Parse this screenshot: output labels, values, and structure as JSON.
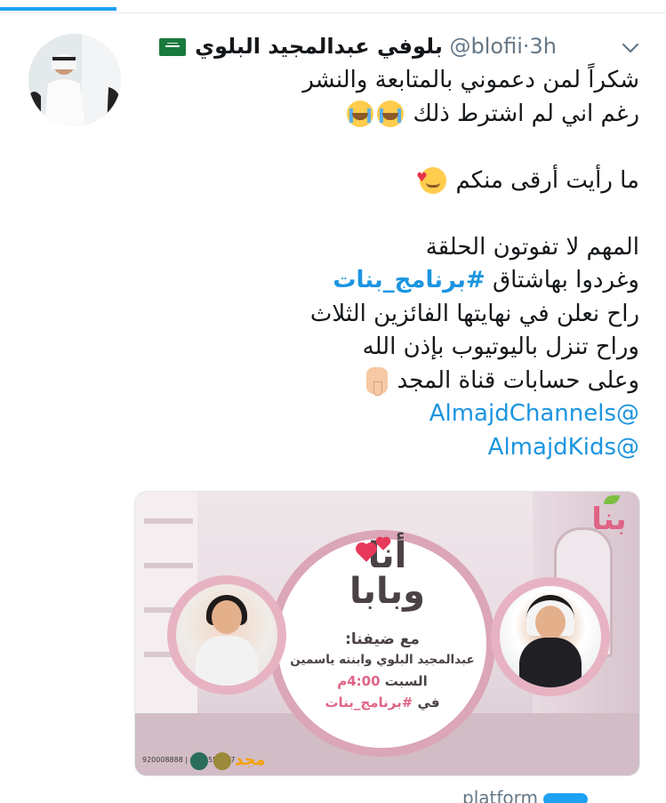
{
  "tweet": {
    "author_name": "بلوفي عبدالمجيد البلوي",
    "handle": "@blofii",
    "separator": "·",
    "time": "3h",
    "lines": [
      "شكراً لمن دعموني بالمتابعة والنشر",
      "رغم اني لم اشترط ذلك",
      "",
      "ما رأيت أرقى منكم",
      "",
      "المهم لا تفوتون الحلقة",
      "وغردوا بهاشتاق",
      "راح نعلن في نهايتها الفائزين الثلاث",
      "وراح تنزل باليوتيوب بإذن الله",
      "وعلى حسابات قناة المجد"
    ],
    "hashtag": "#برنامج_بنات",
    "mentions": [
      "@AlmajdChannels",
      "@AlmajdKids"
    ],
    "emojis": {
      "crying": "loudly-crying-face-icon",
      "love": "smiling-face-with-hearts-icon",
      "pointing": "pointing-down-icon"
    }
  },
  "card": {
    "title_line1": "أنا",
    "title_line2": "وبابا",
    "guest_label": "مع ضيفنا:",
    "guest_names": "عبدالمجيد البلوي وابنته ياسمين",
    "day": "السبت",
    "time": "4:00م",
    "in_label": "في",
    "hashtag": "#برنامج_بنات",
    "brand_logo": "بنا",
    "footer_phone": "920008888 | 0555555777",
    "maj_logo": "مجد"
  },
  "next_tweet_preview": "platform",
  "colors": {
    "accent": "#1da1f2",
    "link": "#1b95e0",
    "muted": "#657786",
    "card_pink": "#e06486"
  }
}
